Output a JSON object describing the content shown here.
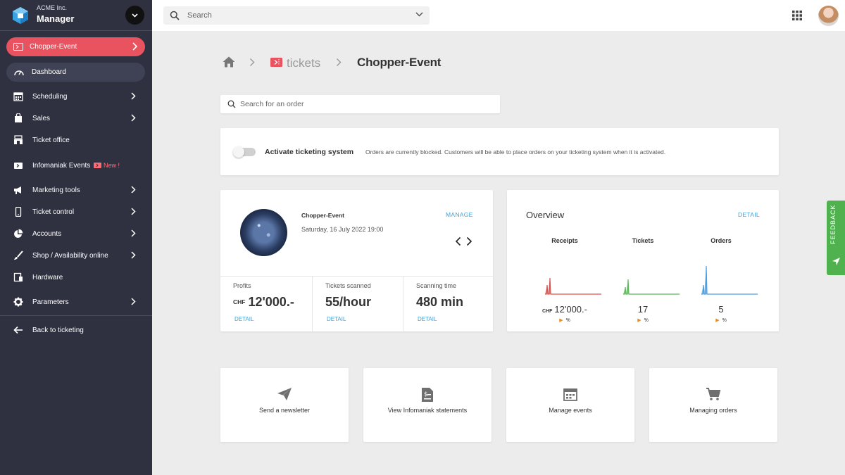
{
  "brand": {
    "company": "ACME Inc.",
    "app": "Manager"
  },
  "sidebar": {
    "event_pill": "Chopper-Event",
    "dashboard": "Dashboard",
    "items": [
      {
        "label": "Scheduling",
        "icon": "calendar-icon",
        "chevron": true
      },
      {
        "label": "Sales",
        "icon": "shopping-bag-icon",
        "chevron": true
      },
      {
        "label": "Ticket office",
        "icon": "store-icon",
        "chevron": false
      },
      {
        "label": "Infomaniak Events",
        "icon": "ticket-icon",
        "chevron": false,
        "badge": "New !"
      },
      {
        "label": "Marketing tools",
        "icon": "megaphone-icon",
        "chevron": true
      },
      {
        "label": "Ticket control",
        "icon": "phone-icon",
        "chevron": true
      },
      {
        "label": "Accounts",
        "icon": "pie-chart-icon",
        "chevron": true
      },
      {
        "label": "Shop / Availability online",
        "icon": "brush-icon",
        "chevron": true
      },
      {
        "label": "Hardware",
        "icon": "hardware-icon",
        "chevron": false
      },
      {
        "label": "Parameters",
        "icon": "gear-icon",
        "chevron": true
      }
    ],
    "back": "Back to ticketing"
  },
  "topbar": {
    "search_placeholder": "Search"
  },
  "breadcrumb": {
    "tickets": "tickets",
    "current": "Chopper-Event"
  },
  "order_search": {
    "placeholder": "Search for an order"
  },
  "activate": {
    "title": "Activate ticketing system",
    "description": "Orders are currently blocked. Customers will be able to place orders on your ticketing system when it is activated.",
    "enabled": false
  },
  "event": {
    "name": "Chopper-Event",
    "date": "Saturday, 16 July 2022 19:00",
    "manage": "MANAGE",
    "stats": [
      {
        "label": "Profits",
        "currency": "CHF",
        "value": "12'000.-",
        "link": "DETAIL"
      },
      {
        "label": "Tickets scanned",
        "currency": "",
        "value": "55/hour",
        "link": "DETAIL"
      },
      {
        "label": "Scanning time",
        "currency": "",
        "value": "480 min",
        "link": "DETAIL"
      }
    ]
  },
  "overview": {
    "title": "Overview",
    "detail": "DETAIL",
    "columns": [
      {
        "head": "Receipts",
        "currency": "CHF",
        "value": "12'000.-",
        "pct": "%",
        "color": "#d9534f"
      },
      {
        "head": "Tickets",
        "currency": "",
        "value": "17",
        "pct": "%",
        "color": "#5cb85c"
      },
      {
        "head": "Orders",
        "currency": "",
        "value": "5",
        "pct": "%",
        "color": "#4a9fe0"
      }
    ]
  },
  "tiles": [
    {
      "label": "Send a newsletter",
      "icon": "paper-plane-icon"
    },
    {
      "label": "View Infomaniak statements",
      "icon": "statement-icon"
    },
    {
      "label": "Manage events",
      "icon": "calendar-icon"
    },
    {
      "label": "Managing orders",
      "icon": "cart-icon"
    }
  ],
  "feedback": {
    "label": "FEEDBACK"
  },
  "colors": {
    "sidebar": "#2f3140",
    "accent_red": "#e8535f",
    "link_blue": "#3ea0d8",
    "feedback_green": "#4fb24f"
  }
}
